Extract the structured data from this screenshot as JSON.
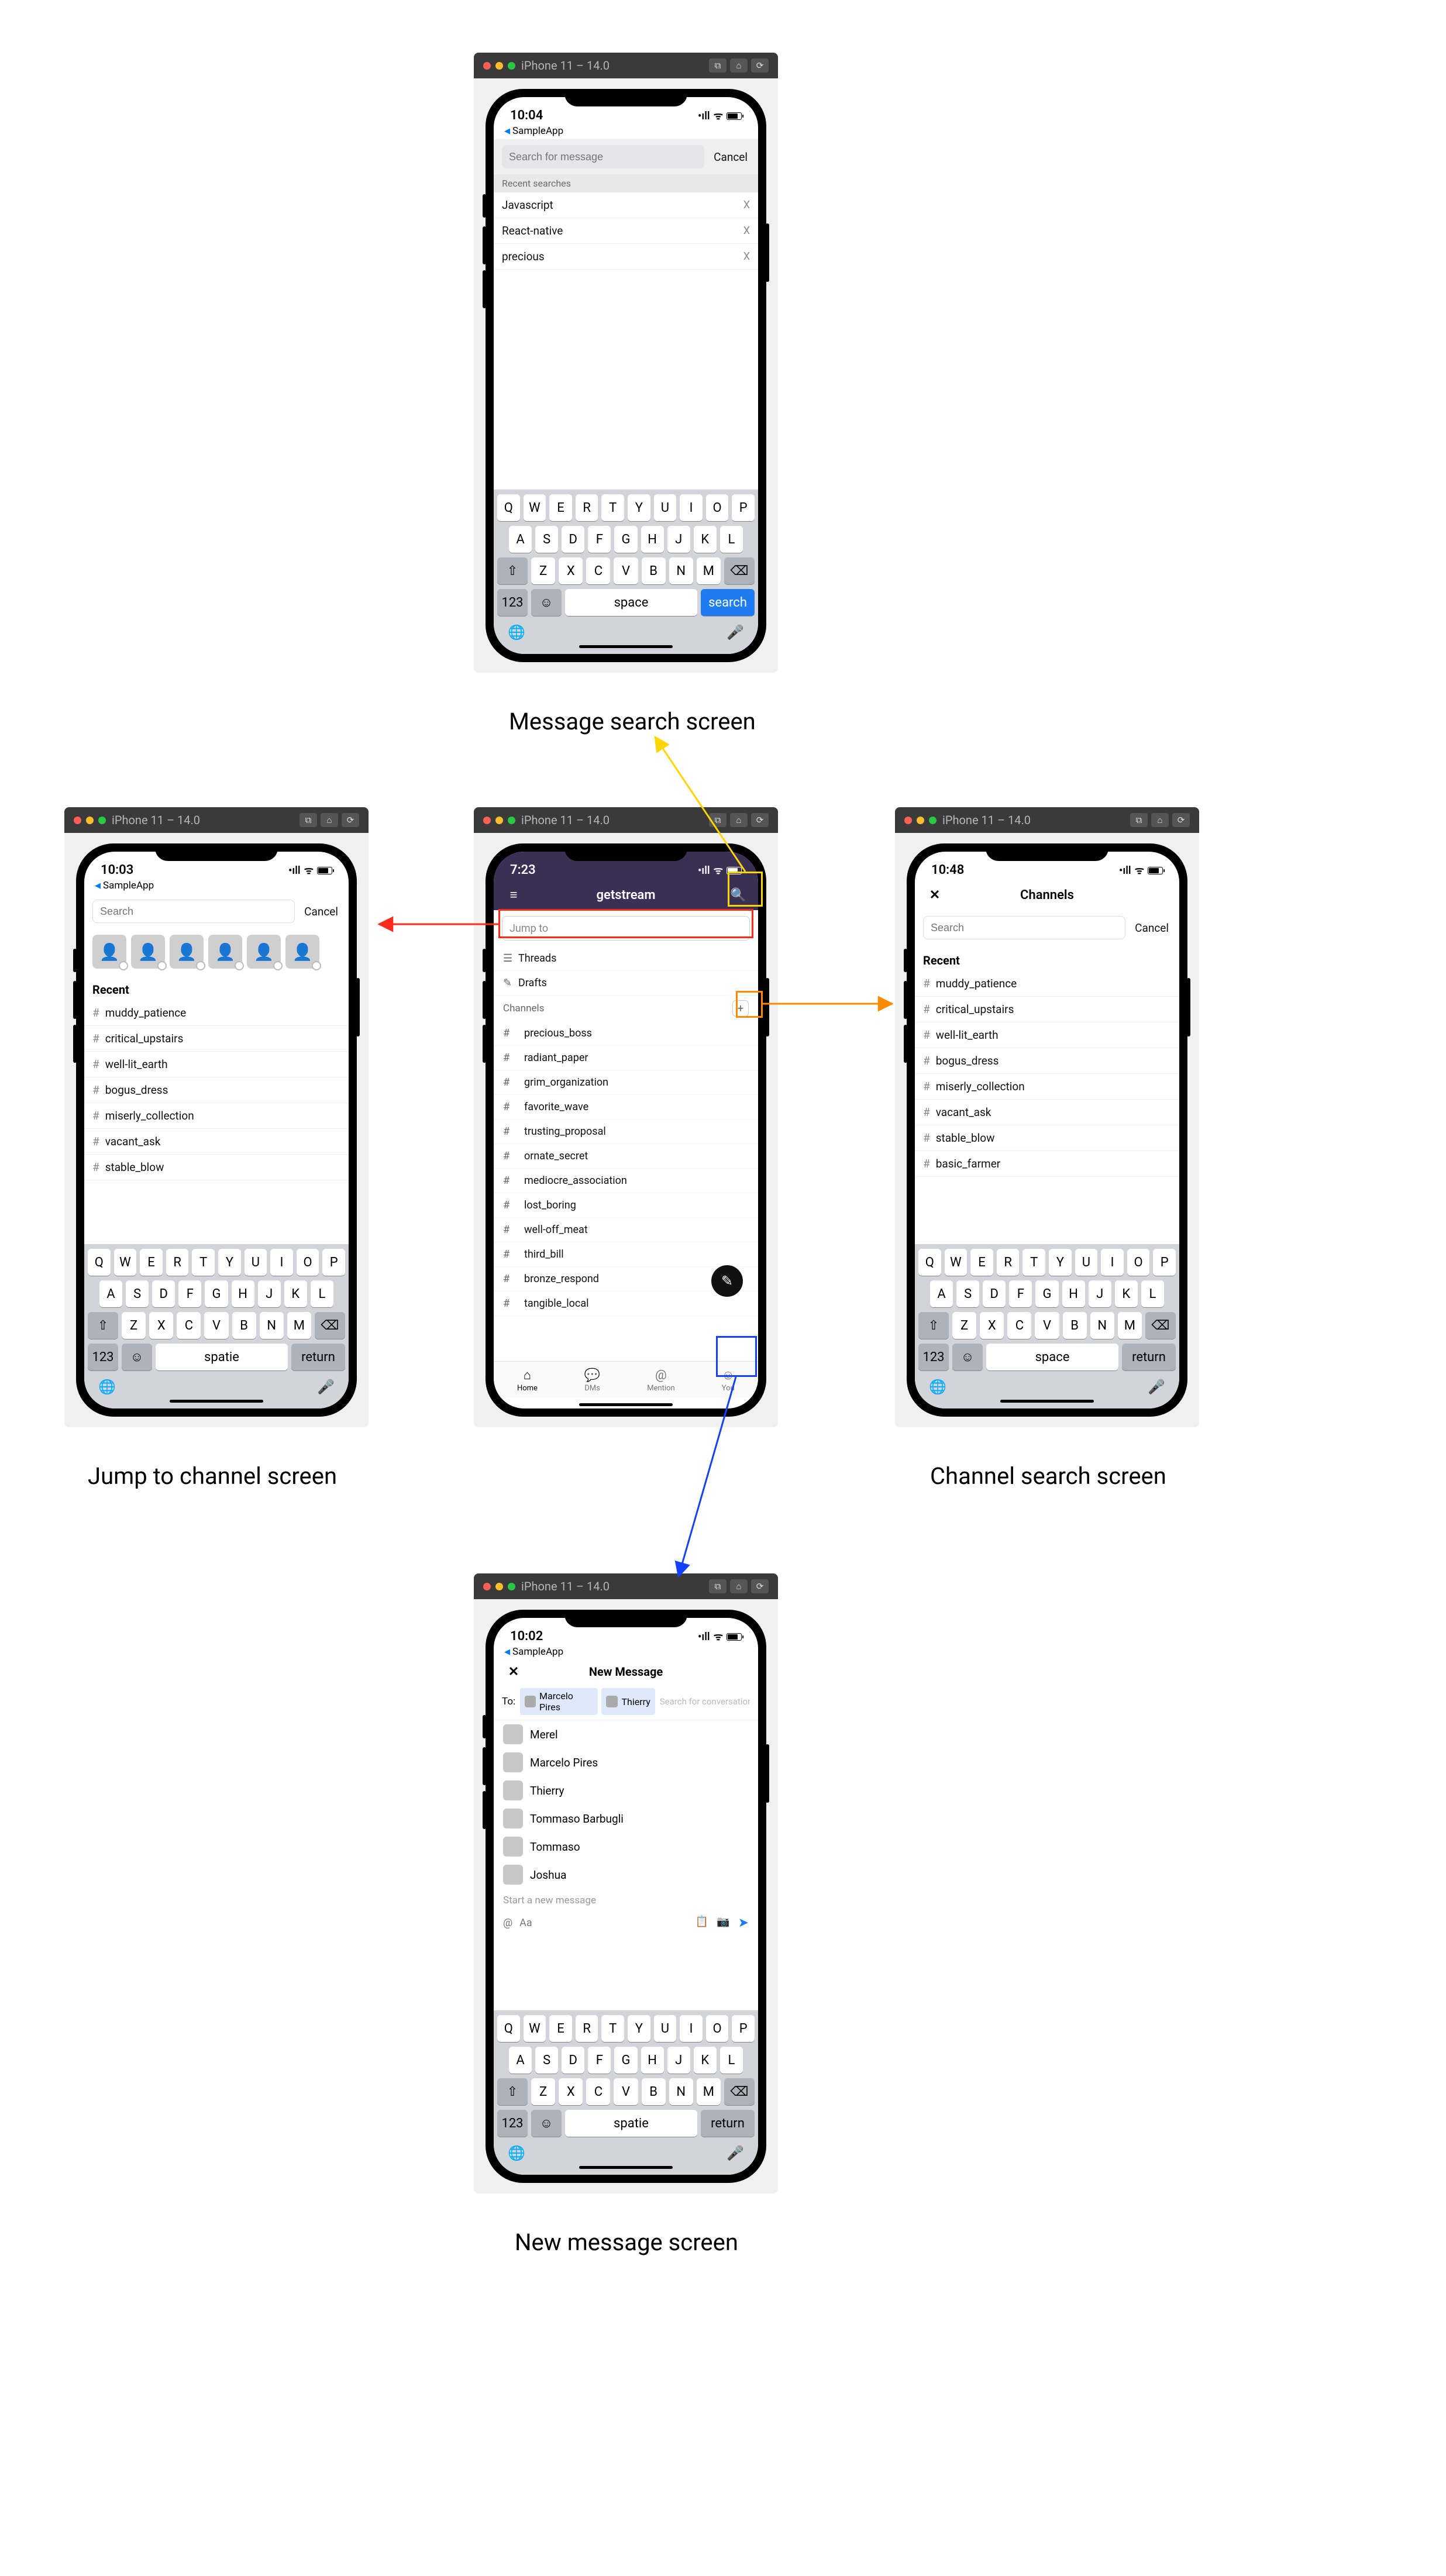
{
  "simulator": {
    "device_label": "iPhone 11 – 14.0",
    "toolbar_icons": [
      "screenshot-icon",
      "home-icon",
      "rotate-icon"
    ]
  },
  "keyboard": {
    "row1": [
      "Q",
      "W",
      "E",
      "R",
      "T",
      "Y",
      "U",
      "I",
      "O",
      "P"
    ],
    "row2": [
      "A",
      "S",
      "D",
      "F",
      "G",
      "H",
      "J",
      "K",
      "L"
    ],
    "row3": [
      "Z",
      "X",
      "C",
      "V",
      "B",
      "N",
      "M"
    ],
    "shift_label": "⇧",
    "backspace_label": "⌫",
    "mode_label": "123",
    "emoji_label": "☺",
    "space_en": "space",
    "space_nl": "spatie",
    "action_search": "search",
    "action_return": "return",
    "globe_label": "🌐",
    "mic_label": "🎤"
  },
  "screens": {
    "message_search": {
      "caption": "Message search screen",
      "time": "10:04",
      "back_label": "SampleApp",
      "search_placeholder": "Search for message",
      "cancel": "Cancel",
      "recent_header": "Recent searches",
      "recent": [
        "Javascript",
        "React-native",
        "precious"
      ]
    },
    "home": {
      "time": "7:23",
      "workspace_icon": "≡",
      "title": "getstream",
      "search_icon": "🔍",
      "jump_placeholder": "Jump to",
      "threads_label": "Threads",
      "drafts_label": "Drafts",
      "channels_header": "Channels",
      "add_channel_label": "+",
      "channels": [
        "precious_boss",
        "radiant_paper",
        "grim_organization",
        "favorite_wave",
        "trusting_proposal",
        "ornate_secret",
        "mediocre_association",
        "lost_boring",
        "well-off_meat",
        "third_bill",
        "bronze_respond",
        "tangible_local"
      ],
      "fab_icon": "✎",
      "tabs": [
        {
          "icon": "⌂",
          "label": "Home"
        },
        {
          "icon": "💬",
          "label": "DMs"
        },
        {
          "icon": "@",
          "label": "Mention"
        },
        {
          "icon": "☺",
          "label": "You"
        }
      ]
    },
    "jump": {
      "caption": "Jump to channel screen",
      "time": "10:03",
      "back_label": "SampleApp",
      "search_placeholder": "Search",
      "cancel": "Cancel",
      "recent_header": "Recent",
      "recent_channels": [
        "muddy_patience",
        "critical_upstairs",
        "well-lit_earth",
        "bogus_dress",
        "miserly_collection",
        "vacant_ask",
        "stable_blow"
      ]
    },
    "channel_search": {
      "caption": "Channel search screen",
      "time": "10:48",
      "title": "Channels",
      "close_icon": "✕",
      "search_placeholder": "Search",
      "cancel": "Cancel",
      "recent_header": "Recent",
      "recent_channels": [
        "muddy_patience",
        "critical_upstairs",
        "well-lit_earth",
        "bogus_dress",
        "miserly_collection",
        "vacant_ask",
        "stable_blow",
        "basic_farmer"
      ]
    },
    "new_message": {
      "caption": "New message  screen",
      "time": "10:02",
      "back_label": "SampleApp",
      "title": "New Message",
      "close_icon": "✕",
      "to_label": "To:",
      "chips": [
        "Marcelo Pires",
        "Thierry"
      ],
      "to_placeholder": "Search for conversation",
      "contacts": [
        "Merel",
        "Marcelo Pires",
        "Thierry",
        "Tommaso Barbugli",
        "Tommaso",
        "Joshua"
      ],
      "compose_placeholder": "Start a new message",
      "at_label": "@",
      "aa_label": "Aa",
      "toolbar_icons": [
        "clipboard-icon",
        "camera-icon"
      ],
      "send_icon": "➤"
    }
  },
  "highlights": {
    "search_icon_box": "yellow",
    "jump_box": "red",
    "add_channel_box": "orange",
    "fab_box": "blue"
  }
}
